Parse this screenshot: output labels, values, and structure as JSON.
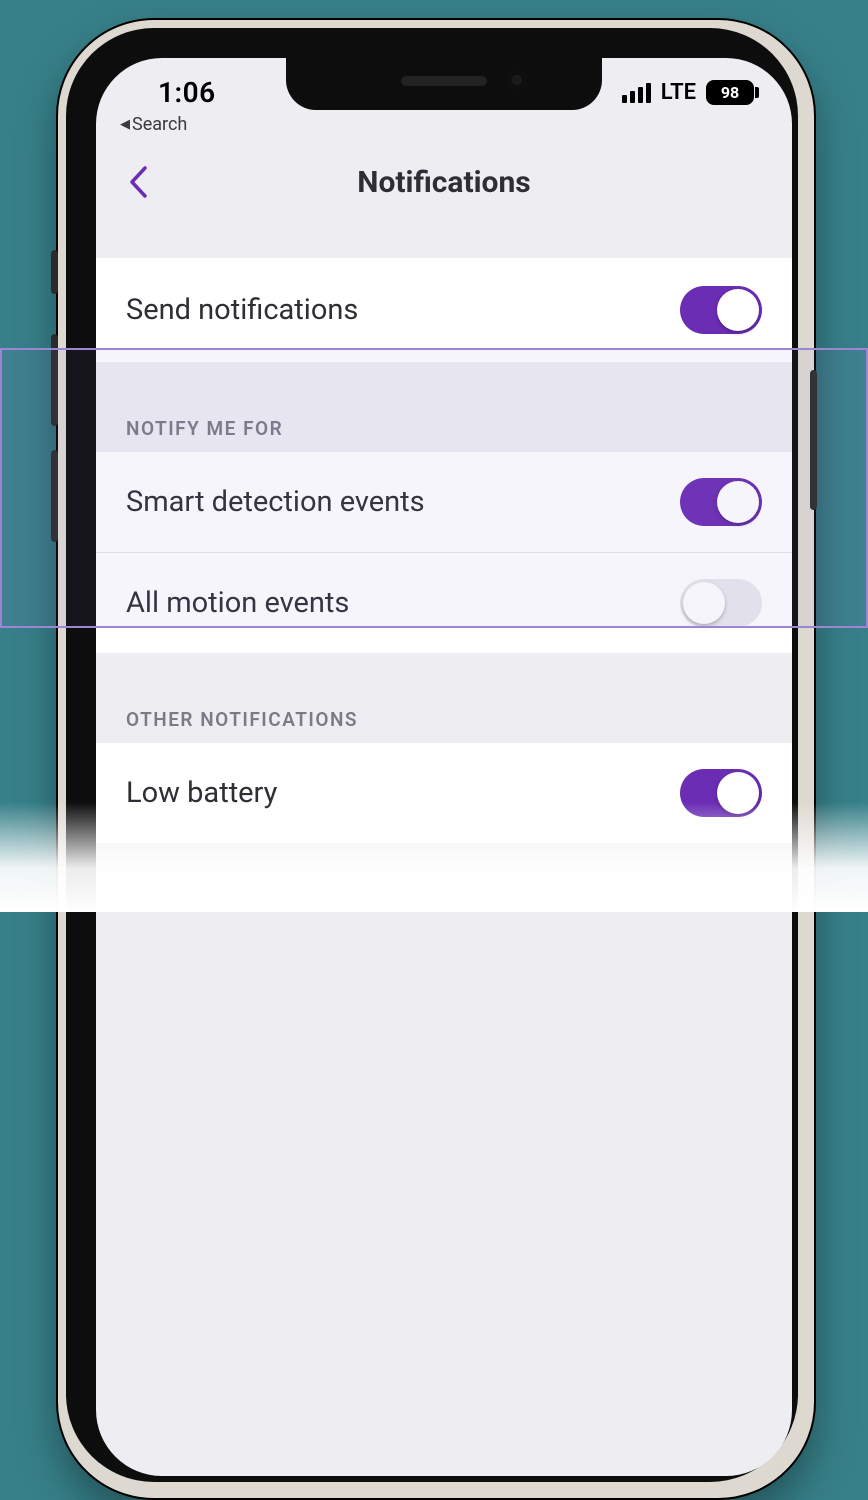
{
  "status": {
    "time": "1:06",
    "network": "LTE",
    "battery": "98",
    "breadcrumb_label": "Search"
  },
  "nav": {
    "title": "Notifications"
  },
  "rows": {
    "send_notifications": {
      "label": "Send notifications",
      "on": true
    }
  },
  "sections": {
    "notify_me_for": {
      "header": "NOTIFY ME FOR",
      "items": [
        {
          "label": "Smart detection events",
          "on": true
        },
        {
          "label": "All motion events",
          "on": false
        }
      ]
    },
    "other_notifications": {
      "header": "OTHER NOTIFICATIONS",
      "items": [
        {
          "label": "Low battery",
          "on": true
        }
      ]
    }
  },
  "colors": {
    "accent": "#6B2DB3"
  }
}
